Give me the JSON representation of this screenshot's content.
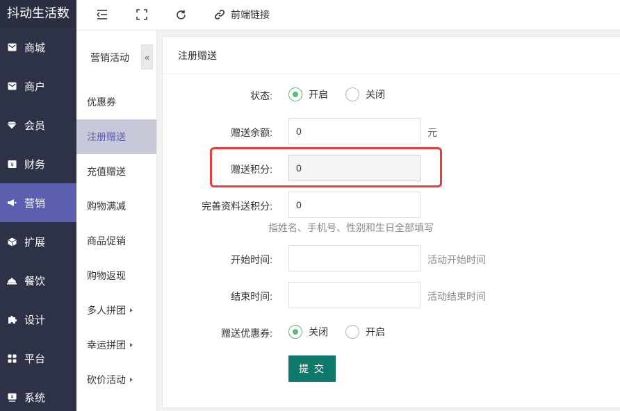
{
  "brand": "抖动生活数",
  "nav": [
    {
      "label": "商城",
      "icon": "envelope-icon"
    },
    {
      "label": "商户",
      "icon": "envelope-icon"
    },
    {
      "label": "会员",
      "icon": "diamond-icon"
    },
    {
      "label": "财务",
      "icon": "money-box-icon"
    },
    {
      "label": "营销",
      "icon": "megaphone-icon",
      "active": true
    },
    {
      "label": "扩展",
      "icon": "cube-icon"
    },
    {
      "label": "餐饮",
      "icon": "food-cover-icon"
    },
    {
      "label": "设计",
      "icon": "puzzle-icon"
    },
    {
      "label": "平台",
      "icon": "grid-icon"
    },
    {
      "label": "系统",
      "icon": "monitor-icon"
    }
  ],
  "header": {
    "link_label": "前端链接"
  },
  "submenu": {
    "title": "营销活动",
    "collapse_glyph": "«",
    "items": [
      {
        "label": "优惠券"
      },
      {
        "label": "注册赠送",
        "active": true
      },
      {
        "label": "充值赠送"
      },
      {
        "label": "购物满减"
      },
      {
        "label": "商品促销"
      },
      {
        "label": "购物返现"
      },
      {
        "label": "多人拼团",
        "caret": true
      },
      {
        "label": "幸运拼团",
        "caret": true
      },
      {
        "label": "砍价活动",
        "caret": true
      }
    ]
  },
  "form": {
    "title": "注册赠送",
    "status_label": "状态:",
    "status_on": "开启",
    "status_off": "关闭",
    "balance_label": "赠送余额:",
    "balance_value": "0",
    "balance_unit": "元",
    "points_label": "赠送积分:",
    "points_value": "0",
    "profile_points_label": "完善资料送积分:",
    "profile_points_value": "0",
    "profile_hint": "指姓名、手机号、性别和生日全部填写",
    "start_label": "开始时间:",
    "start_hint": "活动开始时间",
    "end_label": "结束时间:",
    "end_hint": "活动结束时间",
    "coupon_label": "赠送优惠券:",
    "coupon_off": "关闭",
    "coupon_on": "开启",
    "submit_label": "提 交"
  },
  "colors": {
    "nav_bg": "#2e3246",
    "nav_active": "#5c5fb0",
    "radio_checked": "#5fb878",
    "submit_bg": "#0f7a6c",
    "highlight_box": "#e83b3b"
  }
}
